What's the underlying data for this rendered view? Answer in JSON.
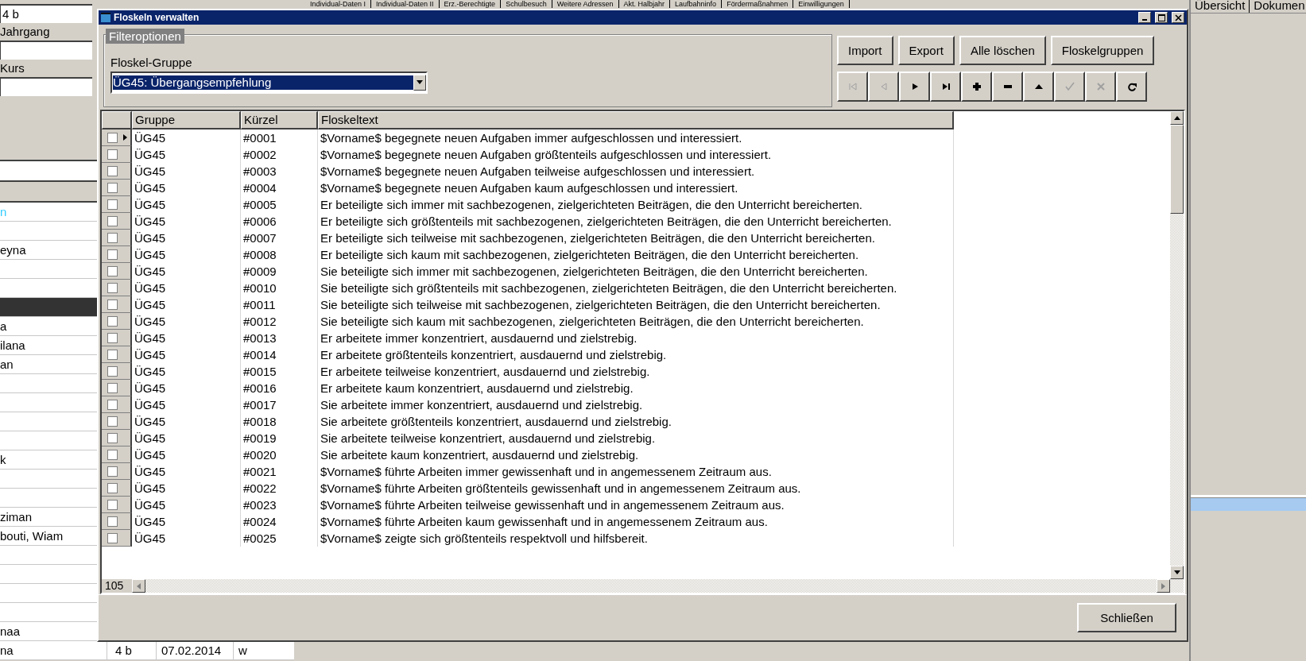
{
  "background_app": {
    "left_panel": {
      "fields": [
        {
          "value": "4 b"
        },
        {
          "label": "Jahrgang"
        },
        {
          "label": "Kurs"
        }
      ],
      "list_rows": [
        {
          "name": "n",
          "selected": false,
          "color": "#33ccff"
        },
        {
          "name": "",
          "selected": false
        },
        {
          "name": "eyna",
          "selected": false
        },
        {
          "name": "",
          "selected": false
        },
        {
          "name": "",
          "selected": false
        },
        {
          "name": "",
          "selected": true
        },
        {
          "name": "a",
          "selected": false
        },
        {
          "name": "ilana",
          "selected": false
        },
        {
          "name": "an",
          "selected": false
        },
        {
          "name": "",
          "selected": false
        },
        {
          "name": "",
          "selected": false
        },
        {
          "name": "",
          "selected": false
        },
        {
          "name": "",
          "selected": false
        },
        {
          "name": "k",
          "selected": false
        },
        {
          "name": "",
          "selected": false
        },
        {
          "name": "",
          "selected": false
        },
        {
          "name": "ziman",
          "selected": false
        },
        {
          "name": "bouti, Wiam",
          "selected": false
        },
        {
          "name": "",
          "selected": false
        },
        {
          "name": "",
          "selected": false
        },
        {
          "name": "",
          "selected": false
        },
        {
          "name": "",
          "selected": false
        },
        {
          "name": "naa",
          "selected": false
        }
      ],
      "last_row": {
        "name": "na",
        "class": "4 b",
        "date": "07.02.2014",
        "sex": "w"
      }
    },
    "tabs": [
      "Individual-Daten I",
      "Individual-Daten II",
      "Erz.-Berechtigte",
      "Schulbesuch",
      "Weitere Adressen",
      "Akt. Halbjahr",
      "Laufbahninfo",
      "Fördermaßnahmen",
      "Einwilligungen"
    ],
    "right_tabs": [
      "Übersicht",
      "Dokumen"
    ]
  },
  "dialog": {
    "title": "Floskeln verwalten",
    "filter": {
      "legend": "Filteroptionen",
      "label": "Floskel-Gruppe",
      "value": "ÜG45: Übergangsempfehlung"
    },
    "buttons": [
      "Import",
      "Export",
      "Alle löschen",
      "Floskelgruppen"
    ],
    "navigator": [
      {
        "kind": "first",
        "disabled": true
      },
      {
        "kind": "prior",
        "disabled": true
      },
      {
        "kind": "next",
        "disabled": false
      },
      {
        "kind": "last",
        "disabled": false
      },
      {
        "kind": "insert",
        "disabled": false
      },
      {
        "kind": "delete",
        "disabled": false
      },
      {
        "kind": "edit",
        "disabled": false
      },
      {
        "kind": "post",
        "disabled": true
      },
      {
        "kind": "cancel",
        "disabled": true
      },
      {
        "kind": "refresh",
        "disabled": false
      }
    ],
    "table": {
      "columns": [
        "Gruppe",
        "Kürzel",
        "Floskeltext"
      ],
      "rows": [
        {
          "checked": false,
          "selected": true,
          "cells": [
            "ÜG45",
            "#0001",
            "$Vorname$ begegnete neuen Aufgaben immer aufgeschlossen und interessiert."
          ]
        },
        {
          "checked": false,
          "selected": false,
          "cells": [
            "ÜG45",
            "#0002",
            "$Vorname$ begegnete neuen Aufgaben größtenteils aufgeschlossen und interessiert."
          ]
        },
        {
          "checked": false,
          "selected": false,
          "cells": [
            "ÜG45",
            "#0003",
            "$Vorname$ begegnete neuen Aufgaben teilweise aufgeschlossen und interessiert."
          ]
        },
        {
          "checked": false,
          "selected": false,
          "cells": [
            "ÜG45",
            "#0004",
            "$Vorname$ begegnete neuen Aufgaben kaum aufgeschlossen und interessiert."
          ]
        },
        {
          "checked": false,
          "selected": false,
          "cells": [
            "ÜG45",
            "#0005",
            "Er beteiligte sich immer mit sachbezogenen, zielgerichteten Beiträgen, die den Unterricht bereicherten."
          ]
        },
        {
          "checked": false,
          "selected": false,
          "cells": [
            "ÜG45",
            "#0006",
            "Er beteiligte sich größtenteils mit sachbezogenen, zielgerichteten Beiträgen, die den Unterricht bereicherten."
          ]
        },
        {
          "checked": false,
          "selected": false,
          "cells": [
            "ÜG45",
            "#0007",
            "Er beteiligte sich teilweise mit sachbezogenen, zielgerichteten Beiträgen, die den Unterricht bereicherten."
          ]
        },
        {
          "checked": false,
          "selected": false,
          "cells": [
            "ÜG45",
            "#0008",
            "Er beteiligte sich kaum mit sachbezogenen, zielgerichteten Beiträgen, die den Unterricht bereicherten."
          ]
        },
        {
          "checked": false,
          "selected": false,
          "cells": [
            "ÜG45",
            "#0009",
            "Sie beteiligte sich immer mit sachbezogenen, zielgerichteten Beiträgen, die den Unterricht bereicherten."
          ]
        },
        {
          "checked": false,
          "selected": false,
          "cells": [
            "ÜG45",
            "#0010",
            "Sie beteiligte sich größtenteils mit sachbezogenen, zielgerichteten Beiträgen, die den Unterricht bereicherten."
          ]
        },
        {
          "checked": false,
          "selected": false,
          "cells": [
            "ÜG45",
            "#0011",
            "Sie beteiligte sich teilweise mit sachbezogenen, zielgerichteten Beiträgen, die den Unterricht bereicherten."
          ]
        },
        {
          "checked": false,
          "selected": false,
          "cells": [
            "ÜG45",
            "#0012",
            "Sie beteiligte sich kaum mit sachbezogenen, zielgerichteten Beiträgen, die den Unterricht bereicherten."
          ]
        },
        {
          "checked": false,
          "selected": false,
          "cells": [
            "ÜG45",
            "#0013",
            "Er arbeitete immer konzentriert, ausdauernd und zielstrebig."
          ]
        },
        {
          "checked": false,
          "selected": false,
          "cells": [
            "ÜG45",
            "#0014",
            "Er arbeitete größtenteils konzentriert, ausdauernd und zielstrebig."
          ]
        },
        {
          "checked": false,
          "selected": false,
          "cells": [
            "ÜG45",
            "#0015",
            "Er arbeitete teilweise konzentriert, ausdauernd und zielstrebig."
          ]
        },
        {
          "checked": false,
          "selected": false,
          "cells": [
            "ÜG45",
            "#0016",
            "Er arbeitete kaum konzentriert, ausdauernd und zielstrebig."
          ]
        },
        {
          "checked": false,
          "selected": false,
          "cells": [
            "ÜG45",
            "#0017",
            "Sie arbeitete immer konzentriert, ausdauernd und zielstrebig."
          ]
        },
        {
          "checked": false,
          "selected": false,
          "cells": [
            "ÜG45",
            "#0018",
            "Sie arbeitete größtenteils konzentriert, ausdauernd und zielstrebig."
          ]
        },
        {
          "checked": false,
          "selected": false,
          "cells": [
            "ÜG45",
            "#0019",
            "Sie arbeitete teilweise konzentriert, ausdauernd und zielstrebig."
          ]
        },
        {
          "checked": false,
          "selected": false,
          "cells": [
            "ÜG45",
            "#0020",
            "Sie arbeitete kaum konzentriert, ausdauernd und zielstrebig."
          ]
        },
        {
          "checked": false,
          "selected": false,
          "cells": [
            "ÜG45",
            "#0021",
            "$Vorname$ führte Arbeiten immer gewissenhaft und in angemessenem Zeitraum aus."
          ]
        },
        {
          "checked": false,
          "selected": false,
          "cells": [
            "ÜG45",
            "#0022",
            "$Vorname$ führte Arbeiten größtenteils gewissenhaft und in angemessenem Zeitraum aus."
          ]
        },
        {
          "checked": false,
          "selected": false,
          "cells": [
            "ÜG45",
            "#0023",
            "$Vorname$ führte Arbeiten teilweise gewissenhaft und in angemessenem Zeitraum aus."
          ]
        },
        {
          "checked": false,
          "selected": false,
          "cells": [
            "ÜG45",
            "#0024",
            "$Vorname$ führte Arbeiten kaum gewissenhaft und in angemessenem Zeitraum aus."
          ]
        },
        {
          "checked": false,
          "selected": false,
          "cells": [
            "ÜG45",
            "#0025",
            "$Vorname$ zeigte sich größtenteils respektvoll und hilfsbereit."
          ]
        }
      ],
      "record_count": "105"
    },
    "close_button": "Schließen"
  }
}
